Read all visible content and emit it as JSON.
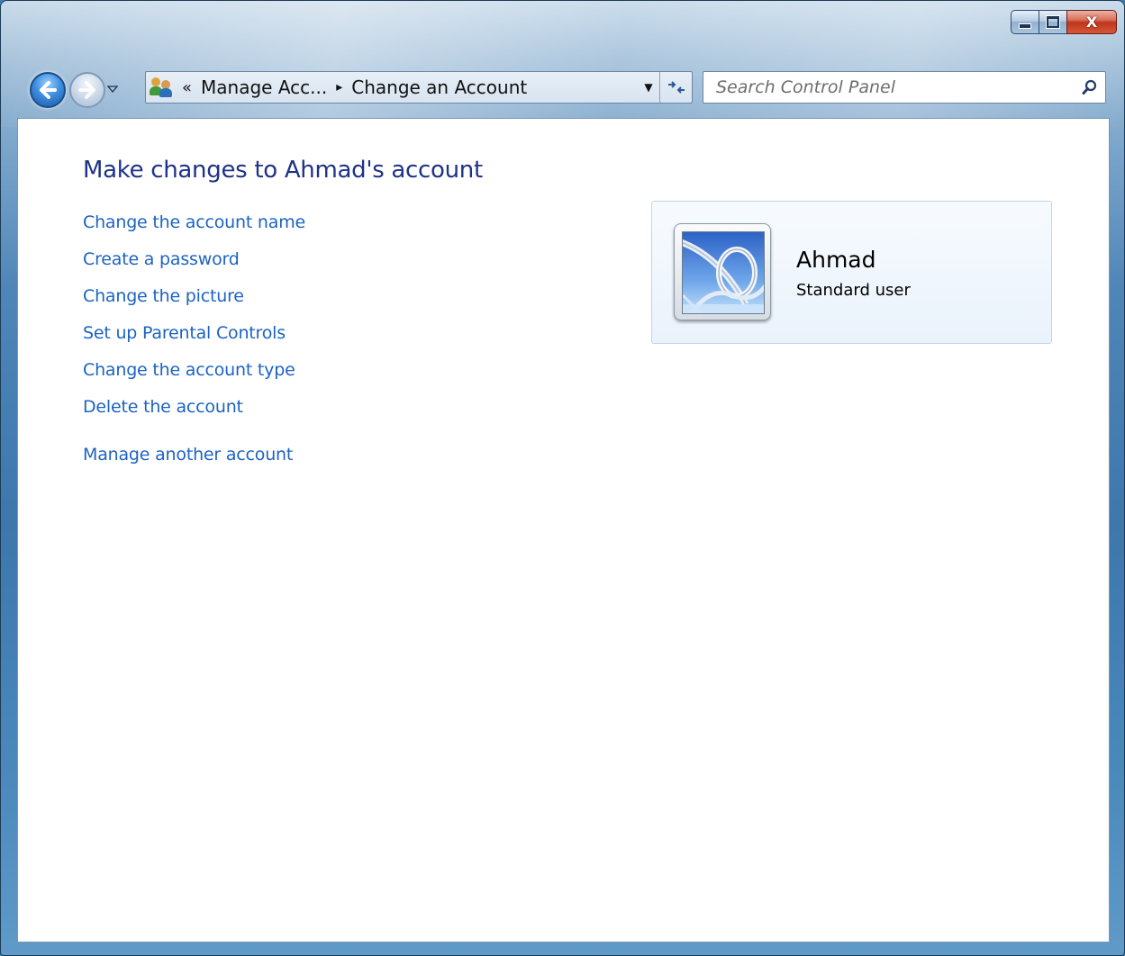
{
  "window": {
    "minimize_icon": "minimize-icon",
    "maximize_icon": "maximize-icon",
    "close_glyph": "X"
  },
  "navigation": {
    "back_icon": "back-arrow-icon",
    "forward_icon": "forward-arrow-icon"
  },
  "addressbar": {
    "overflow_chevron": "«",
    "breadcrumb": [
      "Manage Acc...",
      "Change an Account"
    ],
    "separator": "▸",
    "dropdown_glyph": "▼",
    "refresh_glyph": "↻"
  },
  "search": {
    "placeholder": "Search Control Panel",
    "value": ""
  },
  "page": {
    "title": "Make changes to Ahmad's account",
    "links": [
      "Change the account name",
      "Create a password",
      "Change the picture",
      "Set up Parental Controls",
      "Change the account type",
      "Delete the account"
    ],
    "manage_another": "Manage another account"
  },
  "account": {
    "name": "Ahmad",
    "type": "Standard user"
  },
  "colors": {
    "link": "#1c63c2",
    "title": "#1e3287",
    "card_border": "#bcd5ef"
  }
}
